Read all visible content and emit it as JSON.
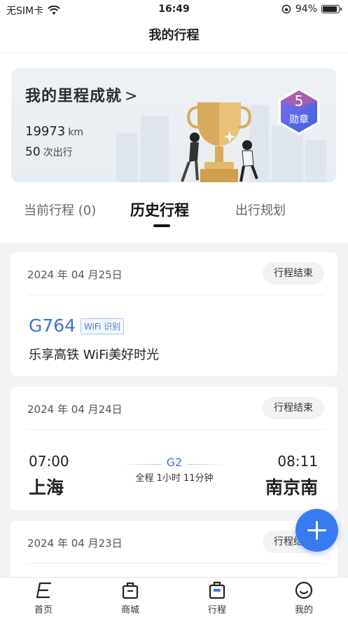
{
  "status_bar": {
    "carrier": "无SIM卡",
    "time": "16:49",
    "battery_percent": "94%",
    "battery_level": 0.94
  },
  "nav": {
    "title": "我的行程"
  },
  "banner": {
    "title": "我的里程成就",
    "distance_value": "19973",
    "distance_unit": "km",
    "trips_value": "50",
    "trips_unit": "次出行",
    "badge_count": "5",
    "badge_label": "勋章"
  },
  "tabs": [
    {
      "label": "当前行程 (0)"
    },
    {
      "label": "历史行程"
    },
    {
      "label": "出行规划"
    }
  ],
  "trips": [
    {
      "date": "2024 年 04 月25日",
      "status": "行程结束",
      "train_no": "G764",
      "wifi_tag": "WiFi 识别",
      "slogan": "乐享高铁 WiFi美好时光"
    },
    {
      "date": "2024 年 04 月24日",
      "status": "行程结束",
      "dep_time": "07:00",
      "dep_city": "上海",
      "train_no": "G2",
      "duration": "全程 1小时 11分钟",
      "arr_time": "08:11",
      "arr_city": "南京南"
    },
    {
      "date": "2024 年 04 月23日",
      "status": "行程结束"
    }
  ],
  "tabbar": [
    {
      "label": "首页",
      "icon": "home-icon"
    },
    {
      "label": "商城",
      "icon": "shop-icon"
    },
    {
      "label": "行程",
      "icon": "trip-icon"
    },
    {
      "label": "我的",
      "icon": "profile-icon"
    }
  ],
  "colors": {
    "accent": "#3a7af0",
    "train_blue": "#3f72d6"
  }
}
